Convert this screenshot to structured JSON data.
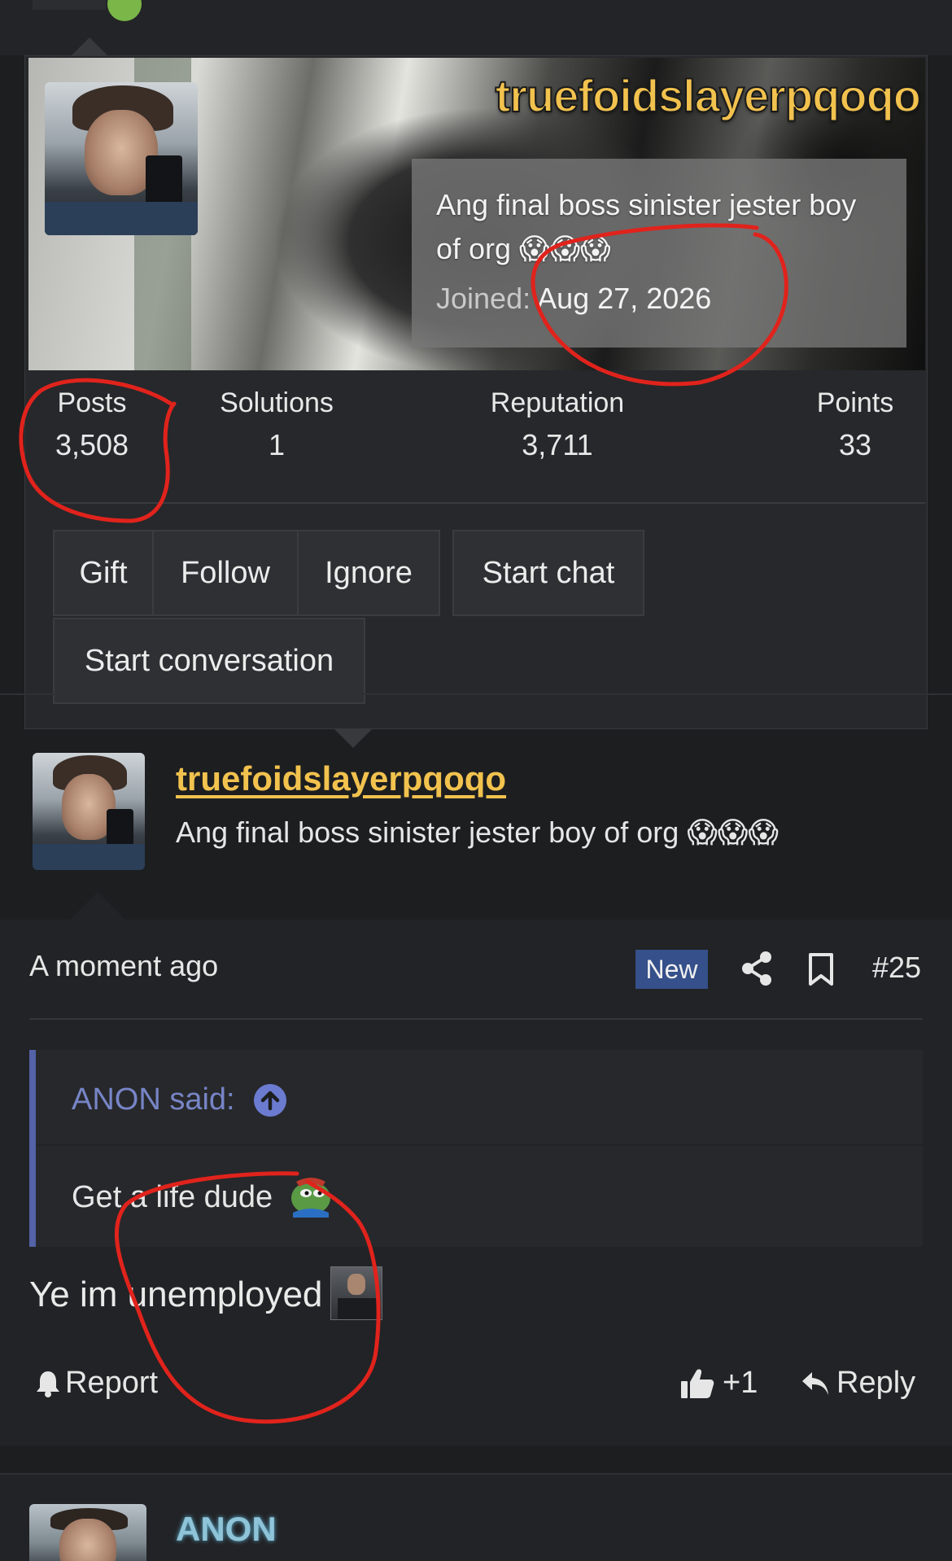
{
  "card": {
    "username": "truefoidslayerpqoqo",
    "title": "Ang final boss sinister jester boy of org 😱😱😱",
    "joined_label": "Joined:",
    "joined_date": "Aug 27, 2026",
    "stats": [
      {
        "label": "Posts",
        "value": "3,508"
      },
      {
        "label": "Solutions",
        "value": "1"
      },
      {
        "label": "Reputation",
        "value": "3,711"
      },
      {
        "label": "Points",
        "value": "33"
      }
    ],
    "buttons": {
      "gift": "Gift",
      "follow": "Follow",
      "ignore": "Ignore",
      "start_chat": "Start chat",
      "start_conversation": "Start conversation"
    }
  },
  "post": {
    "username": "truefoidslayerpqoqo",
    "user_title": "Ang final boss sinister jester boy of org 😱😱😱",
    "time": "A moment ago",
    "badge": "New",
    "number": "#25",
    "quote": {
      "author": "ANON said:",
      "body": "Get a life dude"
    },
    "message": "Ye im unemployed",
    "actions": {
      "report": "Report",
      "like_count": "+1",
      "reply": "Reply"
    }
  },
  "next_post": {
    "username": "ANON"
  },
  "colors": {
    "username": "#f2c24e",
    "badge": "#35508a",
    "quote_accent": "#5462a7",
    "annotation": "#e0231c"
  },
  "icons": [
    "share-icon",
    "bookmark-icon",
    "arrow-up-circle-icon",
    "bell-icon",
    "thumbs-up-icon",
    "reply-arrow-icon"
  ]
}
